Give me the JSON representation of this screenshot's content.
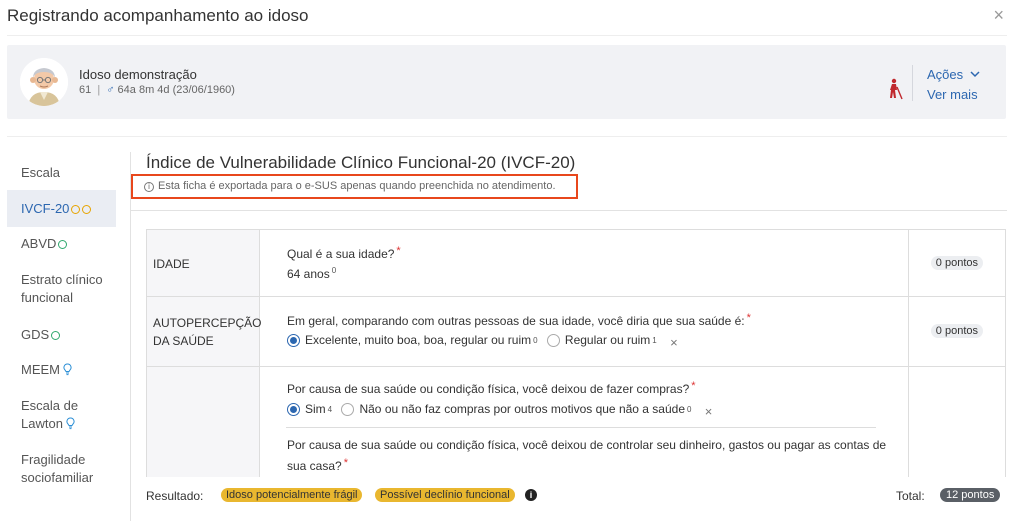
{
  "modal": {
    "title": "Registrando acompanhamento ao idoso",
    "close_icon": "×"
  },
  "patient": {
    "name": "Idoso demonstração",
    "id": "61",
    "separator": "|",
    "sex_symbol": "♂",
    "age": "64a 8m 4d (23/06/1960)",
    "actions_label": "Ações",
    "see_more_label": "Ver mais"
  },
  "sidebar": {
    "items": [
      {
        "label": "Escala"
      },
      {
        "label": "IVCF-20",
        "active": true
      },
      {
        "label": "ABVD"
      },
      {
        "label": "Estrato clínico funcional"
      },
      {
        "label": "GDS"
      },
      {
        "label": "MEEM"
      },
      {
        "label": "Escala de Lawton"
      },
      {
        "label": "Fragilidade sociofamiliar"
      }
    ]
  },
  "form": {
    "title": "Índice de Vulnerabilidade Clínico Funcional-20 (IVCF-20)",
    "info_text": "Esta ficha é exportada para o e-SUS apenas quando preenchida no atendimento.",
    "rows": [
      {
        "group": "IDADE",
        "question": "Qual é a sua idade?",
        "answer": "64 anos",
        "answer_score": "0",
        "points": "0 pontos"
      },
      {
        "group": "AUTOPERCEPÇÃO DA SAÚDE",
        "question": "Em geral, comparando com outras pessoas de sua idade, você diria que sua saúde é:",
        "options": [
          {
            "label": "Excelente, muito boa, boa, regular ou ruim",
            "score": "0",
            "selected": true
          },
          {
            "label": "Regular ou ruim",
            "score": "1",
            "selected": false
          }
        ],
        "points": "0 pontos"
      },
      {
        "group": "",
        "question": "Por causa de sua saúde ou condição física, você deixou de fazer compras?",
        "options": [
          {
            "label": "Sim",
            "score": "4",
            "selected": true
          },
          {
            "label": "Não ou não faz compras por outros motivos que não a saúde",
            "score": "0",
            "selected": false
          }
        ]
      },
      {
        "group": "",
        "question": "Por causa de sua saúde ou condição física, você deixou de controlar seu dinheiro, gastos ou pagar as contas de sua casa?"
      }
    ],
    "required_mark": "*",
    "clear_icon": "×"
  },
  "footer": {
    "result_label": "Resultado:",
    "tags": [
      "Idoso potencialmente frágil",
      "Possível declínio funcional"
    ],
    "info_icon": "i",
    "total_label": "Total:",
    "total_value": "12 pontos"
  },
  "colors": {
    "accent": "#2c67b0",
    "highlight_border": "#e8471c",
    "tag_yellow": "#e9b72f",
    "ring_yellow": "#e7a400",
    "ring_green": "#2fa86d",
    "required": "#d33"
  }
}
